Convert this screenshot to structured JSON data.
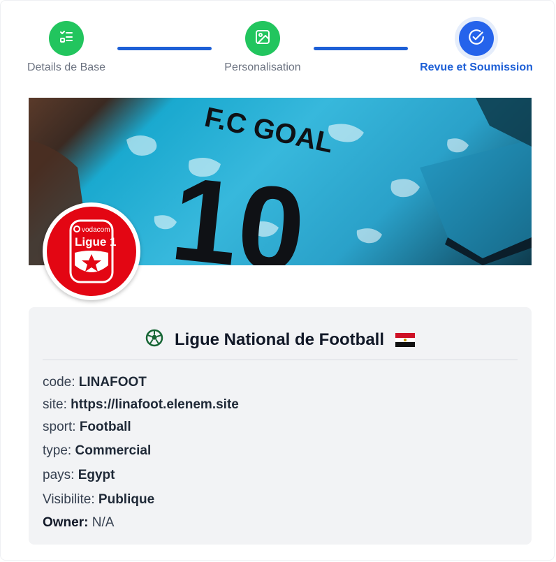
{
  "stepper": {
    "steps": [
      {
        "label": "Details de Base",
        "icon": "checklist-icon",
        "state": "complete",
        "color": "#22c55e"
      },
      {
        "label": "Personalisation",
        "icon": "image-icon",
        "state": "complete",
        "color": "#22c55e"
      },
      {
        "label": "Revue et Soumission",
        "icon": "check-circle-icon",
        "state": "active",
        "color": "#2563eb"
      }
    ],
    "connector_color": "#1d5fd6"
  },
  "banner": {
    "jersey_text": "F.C GOAL",
    "jersey_number": "10"
  },
  "logo": {
    "brand_text": "vodacom",
    "league_text": "Ligue 1",
    "color": "#e30613"
  },
  "card": {
    "title": "Ligue National de Football",
    "title_icon": "soccer-ball-icon",
    "flag": "egypt-flag",
    "fields": [
      {
        "key": "code:",
        "value": "LINAFOOT"
      },
      {
        "key": "site:",
        "value": "https://linafoot.elenem.site"
      },
      {
        "key": "sport:",
        "value": "Football"
      },
      {
        "key": "type:",
        "value": "Commercial"
      },
      {
        "key": "pays:",
        "value": "Egypt"
      },
      {
        "key": "Visibilite:",
        "value": "Publique"
      }
    ],
    "owner": {
      "key": "Owner:",
      "value": "N/A"
    }
  }
}
